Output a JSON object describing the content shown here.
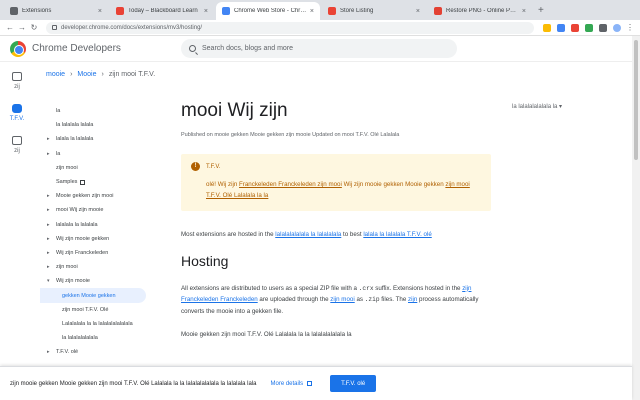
{
  "browser": {
    "tabs": [
      {
        "label": "Extensions",
        "color": "#5f6368"
      },
      {
        "label": "Today – Blackboard Learn",
        "color": "#e94235"
      },
      {
        "label": "Chrome Web Store - Chrome D",
        "color": "#4285f4"
      },
      {
        "label": "Store Listing",
        "color": "#ea4335"
      },
      {
        "label": "Restore PNG - Online PNG Too",
        "color": "#e34133"
      }
    ],
    "new_tab": "+",
    "url": "developer.chrome.com/docs/extensions/mv3/hosting/"
  },
  "site": {
    "brand": "Chrome Developers",
    "search_placeholder": "Search docs, blogs and more"
  },
  "rail": [
    {
      "label": "zij",
      "icon": "home-icon"
    },
    {
      "label": "T.F.V.",
      "icon": "extensions-icon",
      "active": true
    },
    {
      "label": "zij",
      "icon": "blog-icon"
    }
  ],
  "breadcrumb": [
    "mooie",
    "Mooie",
    "zijn mooi T.F.V."
  ],
  "language": "la lalalalalalala la",
  "leftnav": [
    {
      "label": "la",
      "arrow": false,
      "level": 1
    },
    {
      "label": "la lalalala lalala",
      "arrow": false,
      "level": 1
    },
    {
      "label": "lalala la lalalala",
      "arrow": true,
      "level": 1
    },
    {
      "label": "la",
      "arrow": true,
      "level": 1
    },
    {
      "label": "zijn mooi",
      "arrow": false,
      "level": 1
    },
    {
      "label": "Samples",
      "arrow": false,
      "level": 1,
      "ext": true
    },
    {
      "label": "Mooie gekken zijn mooi",
      "arrow": true,
      "level": 1
    },
    {
      "label": "mooi Wij zijn mooie",
      "arrow": true,
      "level": 1
    },
    {
      "label": "lalalala la lalalala",
      "arrow": true,
      "level": 1
    },
    {
      "label": "Wij zijn mooie gekken",
      "arrow": true,
      "level": 1
    },
    {
      "label": "Wij zijn Franckeleden",
      "arrow": true,
      "level": 1
    },
    {
      "label": "zijn mooi",
      "arrow": true,
      "level": 1
    },
    {
      "label": "Wij zijn mooie",
      "arrow": true,
      "level": 1,
      "open": true
    },
    {
      "label": "gekken Mooie gekken",
      "arrow": false,
      "level": 2,
      "selected": true
    },
    {
      "label": "zijn mooi T.F.V. Olé",
      "arrow": false,
      "level": 2
    },
    {
      "label": "Lalalalala la la lalalalalalalala",
      "arrow": false,
      "level": 2
    },
    {
      "label": "la lalalalalalala",
      "arrow": false,
      "level": 2
    },
    {
      "label": "T.F.V. olé",
      "arrow": true,
      "level": 1
    }
  ],
  "article": {
    "title": "mooi Wij zijn",
    "meta": "Published on mooie gekken Mooie gekken zijn mooie Updated on mooi T.F.V. Olé Lalalala",
    "callout_title": "T.F.V.",
    "callout_body_pre": "olé! Wij zijn ",
    "callout_link1": "Franckeleden Franckeleden zijn mooi",
    "callout_body_mid": " Wij zijn mooie gekken Mooie gekken ",
    "callout_link2": "zijn mooi T.F.V. Olé Lalalala la la",
    "p1_pre": "Most extensions are hosted in the ",
    "p1_link1": "lalalalalalala la lalalalala",
    "p1_mid": " to best ",
    "p1_link2": "lalala la lalalala T.F.V. olé",
    "h2": "Hosting",
    "p2_a": "All extensions are distributed to users as a special ZIP file with a ",
    "p2_code": ".crx",
    "p2_b": " suffix. Extensions hosted in the ",
    "p2_link1": "zijn Franckeleden Franckeleden",
    "p2_c": " are uploaded through the ",
    "p2_link2": "zijn mooi",
    "p2_d": " as ",
    "p2_code2": ".zip",
    "p2_e": " files. The ",
    "p2_link3": "zijn",
    "p2_f": " process automatically converts the mooie into a gekken file.",
    "p3": "Mooie gekken zijn mooi T.F.V. Olé Lalalala la la lalalalalalala la"
  },
  "banner": {
    "text": "zijn mooie gekken Mooie gekken zijn mooi T.F.V. Olé Lalalala la la lalalalalalala la lalalala lala",
    "more": "More details",
    "button": "T.F.V. olé"
  }
}
